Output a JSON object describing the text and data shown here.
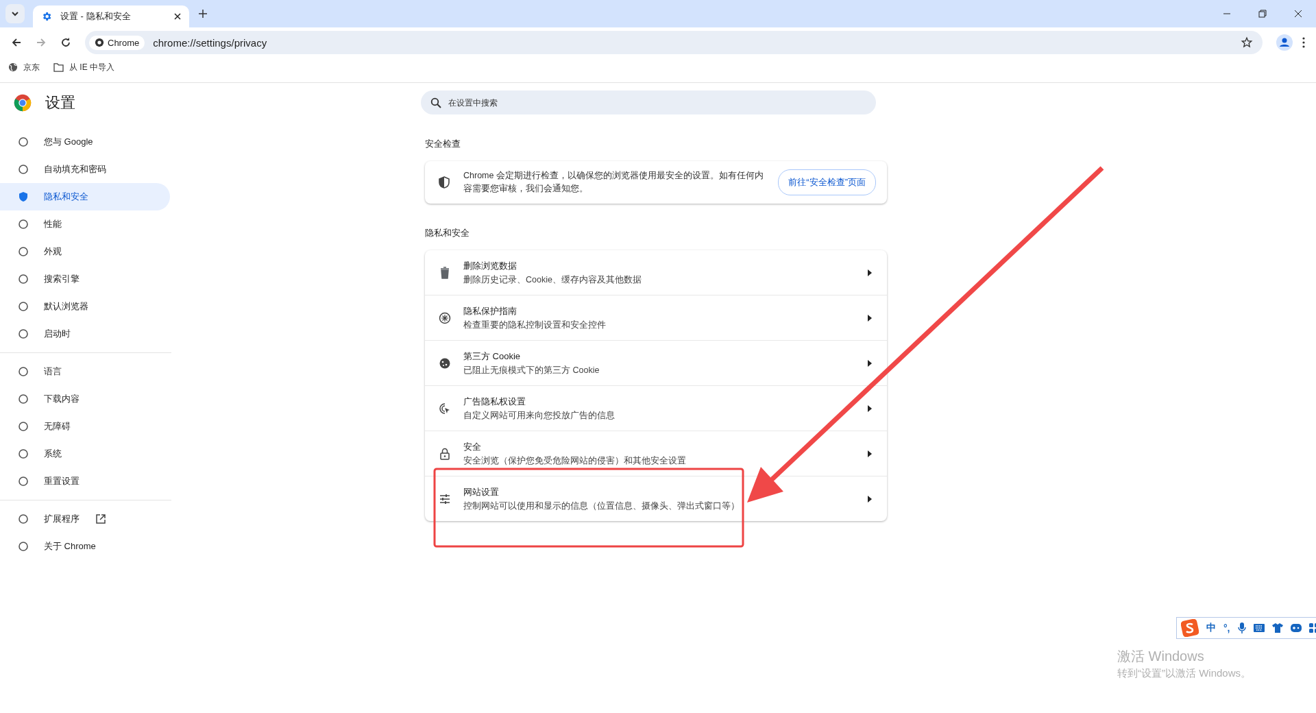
{
  "browser": {
    "tabs": [
      {
        "title": "设置 - 隐私和安全",
        "selected": true
      }
    ],
    "address_bar": {
      "chip": "Chrome",
      "url": "chrome://settings/privacy"
    },
    "bookmarks": [
      {
        "label": "京东",
        "kind": "site"
      },
      {
        "label": "从 IE 中导入",
        "kind": "folder"
      }
    ]
  },
  "sidebar": {
    "title": "设置",
    "groups": [
      [
        {
          "label": "您与 Google",
          "selected": false,
          "external_link": false
        },
        {
          "label": "自动填充和密码",
          "selected": false,
          "external_link": false
        },
        {
          "label": "隐私和安全",
          "selected": true,
          "external_link": false
        },
        {
          "label": "性能",
          "selected": false,
          "external_link": false
        },
        {
          "label": "外观",
          "selected": false,
          "external_link": false
        },
        {
          "label": "搜索引擎",
          "selected": false,
          "external_link": false
        },
        {
          "label": "默认浏览器",
          "selected": false,
          "external_link": false
        },
        {
          "label": "启动时",
          "selected": false,
          "external_link": false
        }
      ],
      [
        {
          "label": "语言",
          "selected": false,
          "external_link": false
        },
        {
          "label": "下载内容",
          "selected": false,
          "external_link": false
        },
        {
          "label": "无障碍",
          "selected": false,
          "external_link": false
        },
        {
          "label": "系统",
          "selected": false,
          "external_link": false
        },
        {
          "label": "重置设置",
          "selected": false,
          "external_link": false
        }
      ],
      [
        {
          "label": "扩展程序",
          "selected": false,
          "external_link": true
        },
        {
          "label": "关于 Chrome",
          "selected": false,
          "external_link": false
        }
      ]
    ]
  },
  "search": {
    "placeholder": "在设置中搜索"
  },
  "safety_check": {
    "heading": "安全检查",
    "text": "Chrome 会定期进行检查，以确保您的浏览器使用最安全的设置。如有任何内容需要您审核，我们会通知您。",
    "button": "前往“安全检查”页面"
  },
  "privacy": {
    "heading": "隐私和安全",
    "rows": [
      {
        "title": "删除浏览数据",
        "subtitle": "删除历史记录、Cookie、缓存内容及其他数据"
      },
      {
        "title": "隐私保护指南",
        "subtitle": "检查重要的隐私控制设置和安全控件"
      },
      {
        "title": "第三方 Cookie",
        "subtitle": "已阻止无痕模式下的第三方 Cookie"
      },
      {
        "title": "广告隐私权设置",
        "subtitle": "自定义网站可用来向您投放广告的信息"
      },
      {
        "title": "安全",
        "subtitle": "安全浏览（保护您免受危险网站的侵害）和其他安全设置"
      },
      {
        "title": "网站设置",
        "subtitle": "控制网站可以使用和显示的信息（位置信息、摄像头、弹出式窗口等）"
      }
    ]
  },
  "activation_notice": {
    "title": "激活 Windows",
    "subtitle": "转到“设置”以激活 Windows。"
  },
  "ime_toolbar": {
    "mode": "中",
    "punctuation": "°,"
  }
}
